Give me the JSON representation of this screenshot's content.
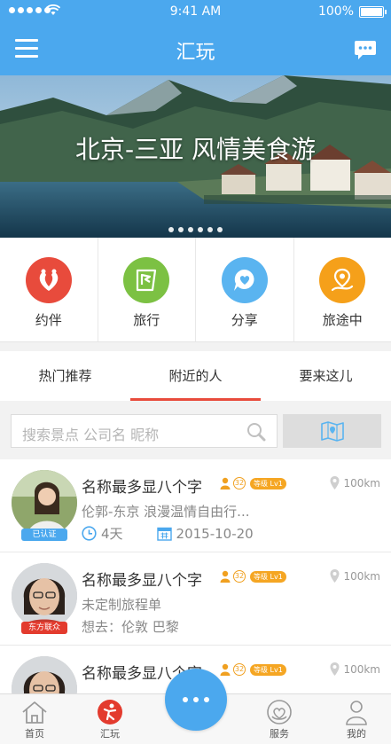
{
  "status": {
    "time": "9:41 AM",
    "battery": "100%"
  },
  "nav": {
    "title": "汇玩",
    "menu_icon": "menu-icon",
    "chat_icon": "chat-bubble-icon"
  },
  "banner": {
    "caption": "北京-三亚 风情美食游",
    "pages": 6
  },
  "features": [
    {
      "label": "约伴",
      "color": "#e84b3c",
      "icon": "companion-icon"
    },
    {
      "label": "旅行",
      "color": "#7cc143",
      "icon": "flag-map-icon"
    },
    {
      "label": "分享",
      "color": "#5ab4f0",
      "icon": "heart-bubble-icon"
    },
    {
      "label": "旅途中",
      "color": "#f5a01a",
      "icon": "route-pin-icon"
    }
  ],
  "tabs": [
    {
      "label": "热门推荐",
      "active": false
    },
    {
      "label": "附近的人",
      "active": true
    },
    {
      "label": "要来这儿",
      "active": false
    }
  ],
  "search": {
    "placeholder": "搜索景点 公司名 昵称"
  },
  "people": [
    {
      "name": "名称最多显八个字",
      "age": "32",
      "level": "等级 Lv1",
      "distance": "100km",
      "badge": "已认证",
      "subtitle": "伦郭-东京 浪漫温情自由行...",
      "days": "4天",
      "date": "2015-10-20"
    },
    {
      "name": "名称最多显八个字",
      "age": "32",
      "level": "等级 Lv1",
      "distance": "100km",
      "badge": "东方联众",
      "subtitle": "未定制旅程单",
      "want": "想去：伦敦 巴黎"
    },
    {
      "name": "名称最多显八个字",
      "age": "32",
      "level": "等级 Lv1",
      "distance": "100km"
    }
  ],
  "bottom_nav": [
    {
      "label": "首页",
      "icon": "home-icon"
    },
    {
      "label": "汇玩",
      "icon": "huiwan-logo-icon"
    },
    {
      "label": "服务",
      "icon": "service-icon"
    },
    {
      "label": "我的",
      "icon": "profile-icon"
    }
  ],
  "colors": {
    "primary": "#4ba8ee",
    "accent": "#e84b3c",
    "level": "#f5a623"
  }
}
